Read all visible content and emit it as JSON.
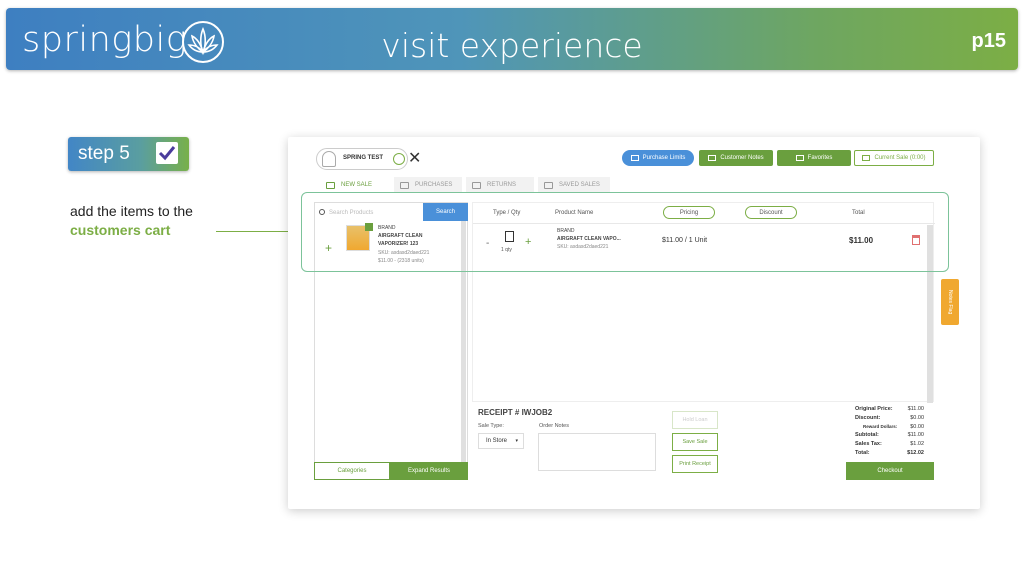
{
  "banner": {
    "brand": "springbig",
    "title": "visit experience",
    "page": "p15"
  },
  "step": {
    "label": "step 5"
  },
  "caption": {
    "line1": "add the items to the",
    "line2": "customers cart"
  },
  "app": {
    "customer_name": "SPRING TEST",
    "buttons": {
      "purchase_limits": "Purchase Limits",
      "customer_notes": "Customer Notes",
      "favorites": "Favorites",
      "current_sale": "Current Sale (0:00)"
    },
    "tabs": [
      "NEW SALE",
      "PURCHASES",
      "RETURNS",
      "SAVED SALES"
    ],
    "search": {
      "placeholder": "Search Products",
      "button": "Search"
    },
    "product": {
      "brand": "BRAND",
      "name1": "AIRGRAFT CLEAN",
      "name2": "VAPORIZER! 123",
      "sku": "SKU: asdasd2daed221",
      "price": "$11.00 - (2318 units)"
    },
    "left_footer": {
      "categories": "Categories",
      "expand": "Expand Results"
    },
    "cart": {
      "headers": {
        "type_qty": "Type / Qty",
        "product_name": "Product Name",
        "pricing": "Pricing",
        "discount": "Discount",
        "total": "Total"
      },
      "line": {
        "brand": "BRAND",
        "name": "AIRGRAFT CLEAN VAPO...",
        "sku": "SKU: asdasd2daed221",
        "qty": "1 qty",
        "price": "$11.00 / 1 Unit",
        "total": "$11.00"
      }
    },
    "notes_tab": "Notes Flag",
    "receipt": {
      "title": "RECEIPT # IWJOB2",
      "sale_type_label": "Sale Type:",
      "sale_type_value": "In Store",
      "order_notes_label": "Order Notes"
    },
    "actions": {
      "hold": "Hold Loan",
      "save": "Save Sale",
      "print": "Print Receipt"
    },
    "totals": {
      "original_label": "Original Price:",
      "original": "$11.00",
      "discount_label": "Discount:",
      "discount": "$0.00",
      "reward_label": "Reward Dollars:",
      "reward": "$0.00",
      "subtotal_label": "Subtotal:",
      "subtotal": "$11.00",
      "tax_label": "Sales Tax:",
      "tax": "$1.02",
      "total_label": "Total:",
      "total": "$12.02"
    },
    "checkout": "Checkout"
  },
  "colors": {
    "brand_blue": "#4a90d9",
    "brand_green": "#6a9f3e",
    "highlight": "#7cc39a",
    "notes_orange": "#f0a830"
  }
}
